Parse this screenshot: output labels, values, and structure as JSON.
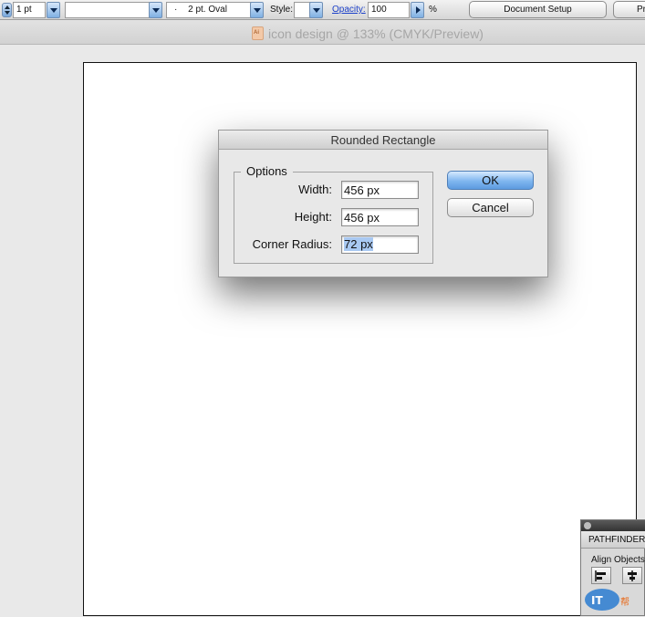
{
  "control_bar": {
    "stroke_weight": "1 pt",
    "variable_width_profile": "",
    "brush_definition": "2 pt. Oval",
    "brush_prefix": "·",
    "style_label": "Style:",
    "opacity_label": "Opacity:",
    "opacity_value": "100",
    "percent": "%",
    "document_setup_label": "Document Setup",
    "preferences_label": "Pr"
  },
  "document": {
    "tab_title": "icon design @ 133% (CMYK/Preview)"
  },
  "dialog": {
    "title": "Rounded Rectangle",
    "options_label": "Options",
    "width_label": "Width:",
    "width_value": "456 px",
    "height_label": "Height:",
    "height_value": "456 px",
    "corner_radius_label": "Corner Radius:",
    "corner_radius_value": "72 px",
    "ok_label": "OK",
    "cancel_label": "Cancel"
  },
  "pathfinder_panel": {
    "tab_label": "PATHFINDER",
    "align_objects_label": "Align Objects"
  },
  "watermark": {
    "text": "IT帮 帮化"
  },
  "colors": {
    "accent_blue": "#7fb6ef",
    "selection": "#a9c9f2",
    "link": "#1a3fc9"
  }
}
